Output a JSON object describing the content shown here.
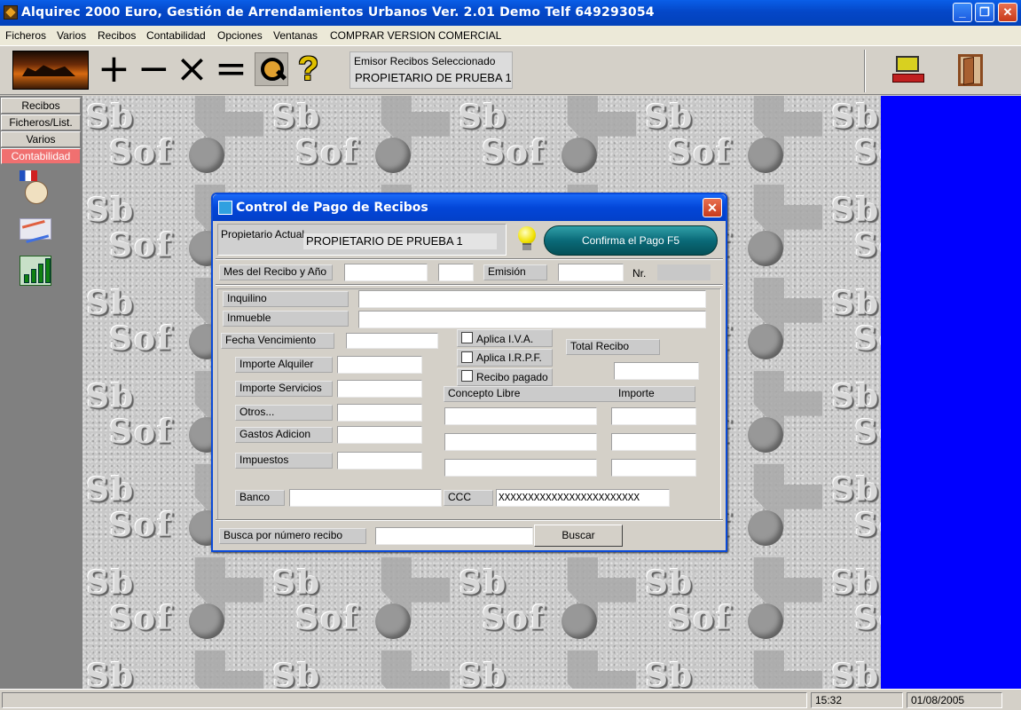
{
  "window": {
    "title": "Alquirec 2000 Euro, Gestión de Arrendamientos Urbanos Ver. 2.01 Demo Telf 649293054",
    "buttons": {
      "minimize": "_",
      "maximize": "❐",
      "close": "✕"
    }
  },
  "menu": [
    "Ficheros",
    "Varios",
    "Recibos",
    "Contabilidad",
    "Opciones",
    "Ventanas",
    "COMPRAR VERSION COMERCIAL"
  ],
  "toolbar": {
    "symbols": {
      "add": "+",
      "subtract": "−",
      "multiply": "×",
      "equals": "="
    },
    "help": "?",
    "emisor_label": "Emisor Recibos Seleccionado",
    "emisor_value": "PROPIETARIO DE PRUEBA 1"
  },
  "sidebar": {
    "tabs": [
      "Recibos",
      "Ficheros/List.",
      "Varios",
      "Contabilidad"
    ],
    "active_tab": "Contabilidad",
    "active_color": "#f07070"
  },
  "workspace": {
    "watermark_line1": "Sb",
    "watermark_line2": "Sof",
    "side_panel_color": "#0000ff"
  },
  "dialog": {
    "title": "Control de Pago de Recibos",
    "close": "✕",
    "propietario_label": "Propietario Actual",
    "propietario_value": "PROPIETARIO DE PRUEBA 1",
    "confirm_button": "Confirma el Pago F5",
    "mes_label": "Mes del Recibo y Año",
    "emision_label": "Emisión",
    "nr_label": "Nr.",
    "inquilino_label": "Inquilino",
    "inmueble_label": "Inmueble",
    "fecha_label": "Fecha Vencimiento",
    "aplica_iva": "Aplica I.V.A.",
    "aplica_irpf": "Aplica I.R.P.F.",
    "recibo_pagado": "Recibo pagado",
    "total_label": "Total Recibo",
    "importe_alquiler": "Importe Alquiler",
    "importe_servicios": "Importe Servicios",
    "otros": "Otros...",
    "gastos": "Gastos Adicion",
    "impuestos": "Impuestos",
    "concepto_libre": "Concepto Libre",
    "importe": "Importe",
    "banco_label": "Banco",
    "ccc_label": "CCC",
    "ccc_value": "XXXXXXXXXXXXXXXXXXXXXXXX",
    "busca_label": "Busca por número recibo",
    "buscar_button": "Buscar"
  },
  "status": {
    "main": "",
    "time": "15:32",
    "date": "01/08/2005"
  }
}
